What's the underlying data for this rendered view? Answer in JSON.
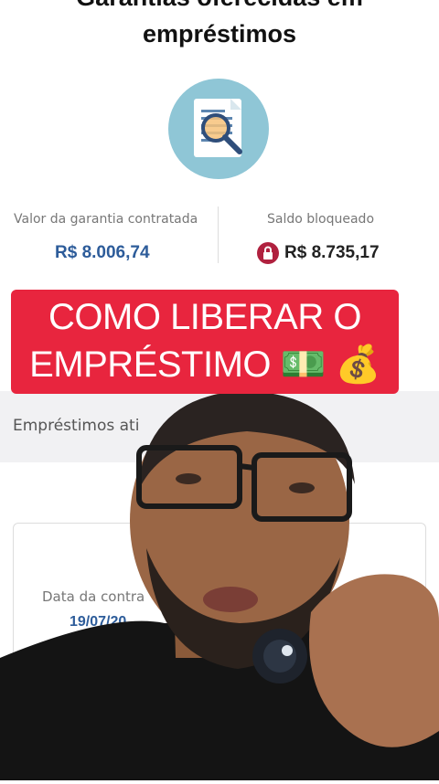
{
  "header": {
    "title_line1": "Garantias oferecidas em",
    "title_line2": "empréstimos"
  },
  "guarantee": {
    "label": "Valor da garantia contratada",
    "value": "R$ 8.006,74"
  },
  "blocked": {
    "label": "Saldo bloqueado",
    "value": "R$ 8.735,17"
  },
  "banner": {
    "line1": "COMO LIBERAR O",
    "line2": "EMPRÉSTIMO 💵 💰"
  },
  "loans": {
    "label": "Empréstimos ati",
    "date_label": "Data da contra",
    "date_value": "19/07/20"
  },
  "colors": {
    "banner": "#e8253e",
    "value_blue": "#2d5c9a",
    "lock": "#b0213f",
    "icon_circle": "#8fc6d6"
  }
}
